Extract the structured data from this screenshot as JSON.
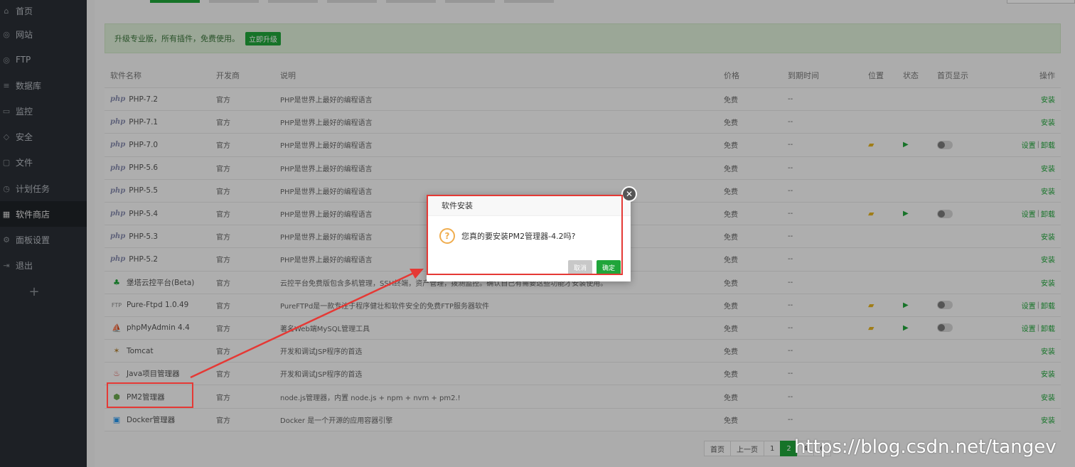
{
  "sidebar": {
    "items": [
      {
        "label": "首页",
        "icon": "home-icon",
        "glyph": "⌂"
      },
      {
        "label": "网站",
        "icon": "globe-icon",
        "glyph": "◎"
      },
      {
        "label": "FTP",
        "icon": "ftp-icon",
        "glyph": "◎"
      },
      {
        "label": "数据库",
        "icon": "database-icon",
        "glyph": "≡"
      },
      {
        "label": "监控",
        "icon": "monitor-icon",
        "glyph": "▭"
      },
      {
        "label": "安全",
        "icon": "shield-icon",
        "glyph": "◇"
      },
      {
        "label": "文件",
        "icon": "folder-icon",
        "glyph": "▢"
      },
      {
        "label": "计划任务",
        "icon": "clock-icon",
        "glyph": "◷"
      },
      {
        "label": "软件商店",
        "icon": "grid-icon",
        "glyph": "▦",
        "active": true
      },
      {
        "label": "面板设置",
        "icon": "gear-icon",
        "glyph": "⚙"
      },
      {
        "label": "退出",
        "icon": "logout-icon",
        "glyph": "⇥"
      }
    ],
    "add_glyph": "+"
  },
  "upgrade": {
    "text": "升级专业版，所有插件，免费使用。",
    "button": "立即升级"
  },
  "table": {
    "headers": {
      "name": "软件名称",
      "dev": "开发商",
      "desc": "说明",
      "price": "价格",
      "expire": "到期时间",
      "pos": "位置",
      "status": "状态",
      "home": "首页显示",
      "op": "操作"
    },
    "rows": [
      {
        "logo": "php",
        "name": "PHP-7.2",
        "dev": "官方",
        "desc": "PHP是世界上最好的编程语言",
        "price": "免费",
        "expire": "--",
        "installed": false
      },
      {
        "logo": "php",
        "name": "PHP-7.1",
        "dev": "官方",
        "desc": "PHP是世界上最好的编程语言",
        "price": "免费",
        "expire": "--",
        "installed": false
      },
      {
        "logo": "php",
        "name": "PHP-7.0",
        "dev": "官方",
        "desc": "PHP是世界上最好的编程语言",
        "price": "免费",
        "expire": "--",
        "installed": true
      },
      {
        "logo": "php",
        "name": "PHP-5.6",
        "dev": "官方",
        "desc": "PHP是世界上最好的编程语言",
        "price": "免费",
        "expire": "--",
        "installed": false
      },
      {
        "logo": "php",
        "name": "PHP-5.5",
        "dev": "官方",
        "desc": "PHP是世界上最好的编程语言",
        "price": "免费",
        "expire": "--",
        "installed": false
      },
      {
        "logo": "php",
        "name": "PHP-5.4",
        "dev": "官方",
        "desc": "PHP是世界上最好的编程语言",
        "price": "免费",
        "expire": "--",
        "installed": true
      },
      {
        "logo": "php",
        "name": "PHP-5.3",
        "dev": "官方",
        "desc": "PHP是世界上最好的编程语言",
        "price": "免费",
        "expire": "--",
        "installed": false
      },
      {
        "logo": "php",
        "name": "PHP-5.2",
        "dev": "官方",
        "desc": "PHP是世界上最好的编程语言",
        "price": "免费",
        "expire": "--",
        "installed": false
      },
      {
        "logo": "icon",
        "icon": "tree-icon",
        "glyph": "♣",
        "color": "#20a53a",
        "name": "堡塔云控平台(Beta)",
        "dev": "官方",
        "desc": "云控平台免费版包含多机管理，SSH终端，资产管理，拨测监控。确认自己有需要这些功能才安装使用。",
        "price": "免费",
        "expire": "--",
        "installed": false
      },
      {
        "logo": "ftp",
        "name": "Pure-Ftpd 1.0.49",
        "dev": "官方",
        "desc": "PureFTPd是一款专注于程序健壮和软件安全的免费FTP服务器软件",
        "price": "免费",
        "expire": "--",
        "installed": true
      },
      {
        "logo": "icon",
        "icon": "sailboat-icon",
        "glyph": "⛵",
        "color": "#e08a1e",
        "name": "phpMyAdmin 4.4",
        "dev": "官方",
        "desc": "著名Web端MySQL管理工具",
        "price": "免费",
        "expire": "--",
        "installed": true
      },
      {
        "logo": "icon",
        "icon": "tomcat-icon",
        "glyph": "✶",
        "color": "#b5863a",
        "name": "Tomcat",
        "dev": "官方",
        "desc": "开发和调试JSP程序的首选",
        "price": "免费",
        "expire": "--",
        "installed": false
      },
      {
        "logo": "icon",
        "icon": "java-icon",
        "glyph": "♨",
        "color": "#d9534f",
        "name": "Java项目管理器",
        "dev": "官方",
        "desc": "开发和调试JSP程序的首选",
        "price": "免费",
        "expire": "--",
        "installed": false
      },
      {
        "logo": "icon",
        "icon": "nodejs-icon",
        "glyph": "⬢",
        "color": "#6aa84f",
        "name": "PM2管理器",
        "dev": "官方",
        "desc": "node.js管理器，内置 node.js + npm + nvm + pm2.!",
        "price": "免费",
        "expire": "--",
        "installed": false
      },
      {
        "logo": "icon",
        "icon": "docker-icon",
        "glyph": "▣",
        "color": "#2496ed",
        "name": "Docker管理器",
        "dev": "官方",
        "desc": "Docker 是一个开源的应用容器引擎",
        "price": "免费",
        "expire": "--",
        "installed": false
      }
    ],
    "op_install": "安装",
    "op_settings": "设置",
    "op_uninstall": "卸载",
    "op_sep": "|",
    "folder_glyph": "▰",
    "play_glyph": "▶"
  },
  "pager": {
    "first": "首页",
    "prev": "上一页",
    "p1": "1",
    "p2": "2",
    "p4": "4",
    "p6": "6"
  },
  "dialog": {
    "title": "软件安装",
    "message": "您真的要安装PM2管理器-4.2吗?",
    "question_glyph": "?",
    "cancel": "取消",
    "ok": "确定",
    "close_glyph": "✕"
  },
  "watermark": "https://blog.csdn.net/tangev",
  "colors": {
    "accent": "#20a53a",
    "annotation": "#e53935"
  }
}
